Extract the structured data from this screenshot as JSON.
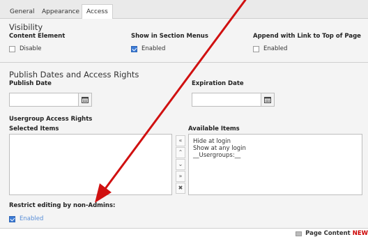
{
  "tabs": [
    "General",
    "Appearance",
    "Access"
  ],
  "visibility": {
    "title": "Visibility",
    "content_element": {
      "label": "Content Element",
      "option": "Disable",
      "checked": false
    },
    "show_in_menus": {
      "label": "Show in Section Menus",
      "option": "Enabled",
      "checked": true
    },
    "append_link": {
      "label": "Append with Link to Top of Page",
      "option": "Enabled",
      "checked": false
    }
  },
  "publish": {
    "title": "Publish Dates and Access Rights",
    "publish_date_label": "Publish Date",
    "publish_date_value": "",
    "expiration_date_label": "Expiration Date",
    "expiration_date_value": "",
    "usergroup_title": "Usergroup Access Rights",
    "selected_label": "Selected Items",
    "available_label": "Available Items",
    "available_items": [
      "Hide at login",
      "Show at any login",
      "__Usergroups:__"
    ],
    "restrict_label": "Restrict editing by non-Admins:",
    "restrict_option": "Enabled",
    "restrict_checked": true
  },
  "footer": {
    "text": "Page Content",
    "badge": "NEW"
  },
  "colors": {
    "accent": "#3c7bd5",
    "arrow": "#d01010",
    "badge": "#cc0000"
  },
  "icons": [
    "calendar-icon",
    "move-top-icon",
    "move-up-icon",
    "move-down-icon",
    "move-bottom-icon",
    "remove-icon",
    "page-content-icon"
  ]
}
